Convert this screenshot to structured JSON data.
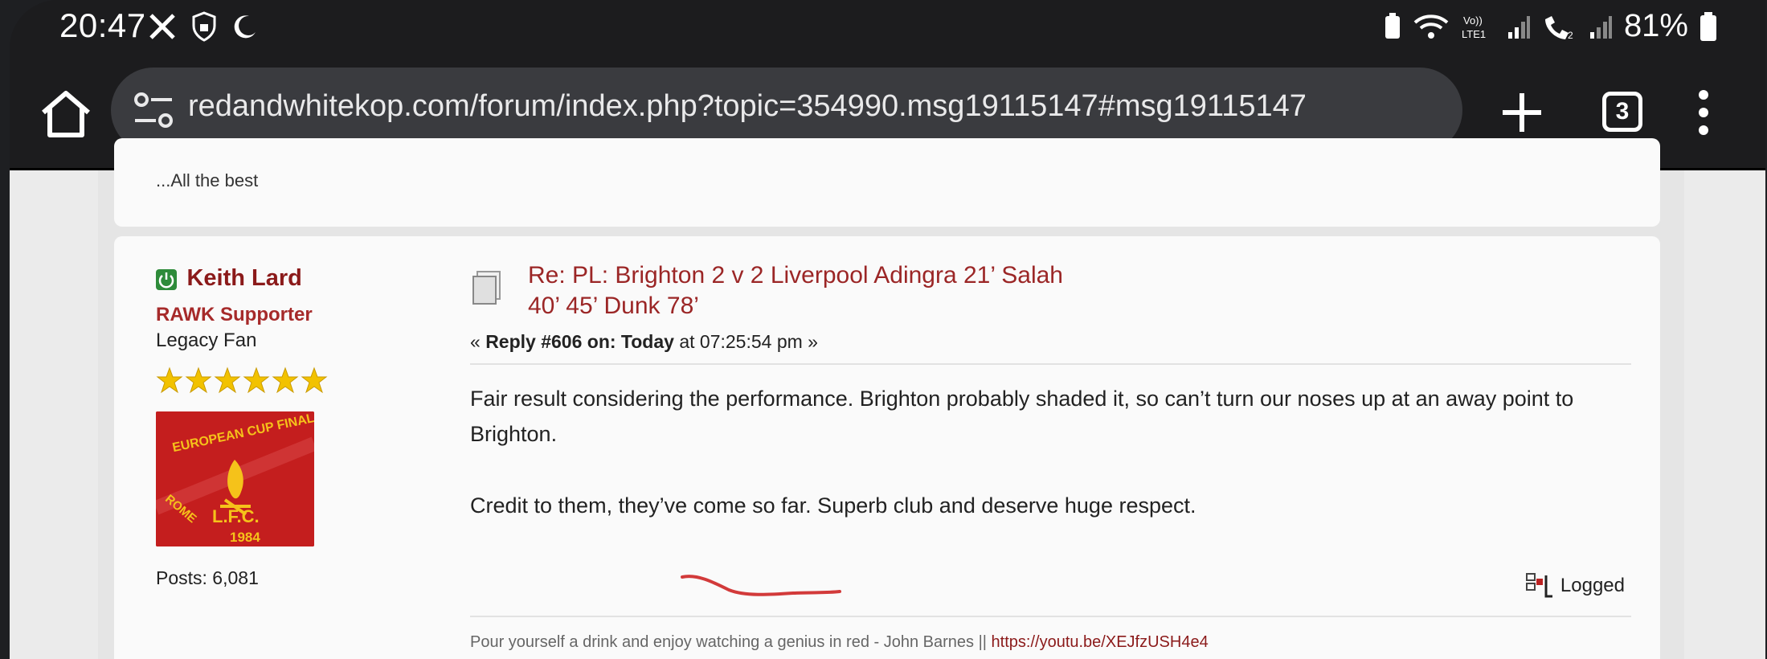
{
  "status_bar": {
    "time": "20:47",
    "left_icons": [
      "x-icon",
      "shield-icon",
      "moon-icon"
    ],
    "right_icons": [
      "battery-saver-icon",
      "wifi-icon",
      "volte-icon",
      "signal-icon",
      "wifi-calling-icon",
      "signal-icon"
    ],
    "volte_label": "Vo)) LTE1",
    "battery_percent": "81%"
  },
  "browser": {
    "url": "redandwhitekop.com/forum/index.php?topic=354990.msg19115147#msg19115147",
    "tab_count": "3"
  },
  "previous_post": {
    "text": "...All the best"
  },
  "post": {
    "poster": {
      "name": "Keith Lard",
      "group": "RAWK Supporter",
      "title": "Legacy Fan",
      "star_count": 6,
      "avatar_text": [
        "EUROPEAN CUP FINAL",
        "L.F.C.",
        "ROME",
        "1984"
      ],
      "posts": "Posts: 6,081"
    },
    "subject": "Re: PL: Brighton 2 v 2 Liverpool Adingra 21’ Salah 40’ 45’ Dunk 78’",
    "reply_prefix": "«",
    "reply_label": "Reply #606 on: Today",
    "reply_time": "at 07:25:54 pm »",
    "body": [
      "Fair result considering the performance. Brighton probably shaded it, so can’t turn our noses up at an away point to Brighton.",
      "Credit to them, they’ve come so far. Superb club and deserve huge respect."
    ],
    "logged_label": "Logged",
    "signature": "Pour yourself a drink and enjoy watching a genius in red - John Barnes ||",
    "signature_link": "https://youtu.be/XEJfzUSH4e4"
  },
  "colors": {
    "accent": "#9b2626",
    "online": "#2e8b3a",
    "star": "#f2c200"
  }
}
